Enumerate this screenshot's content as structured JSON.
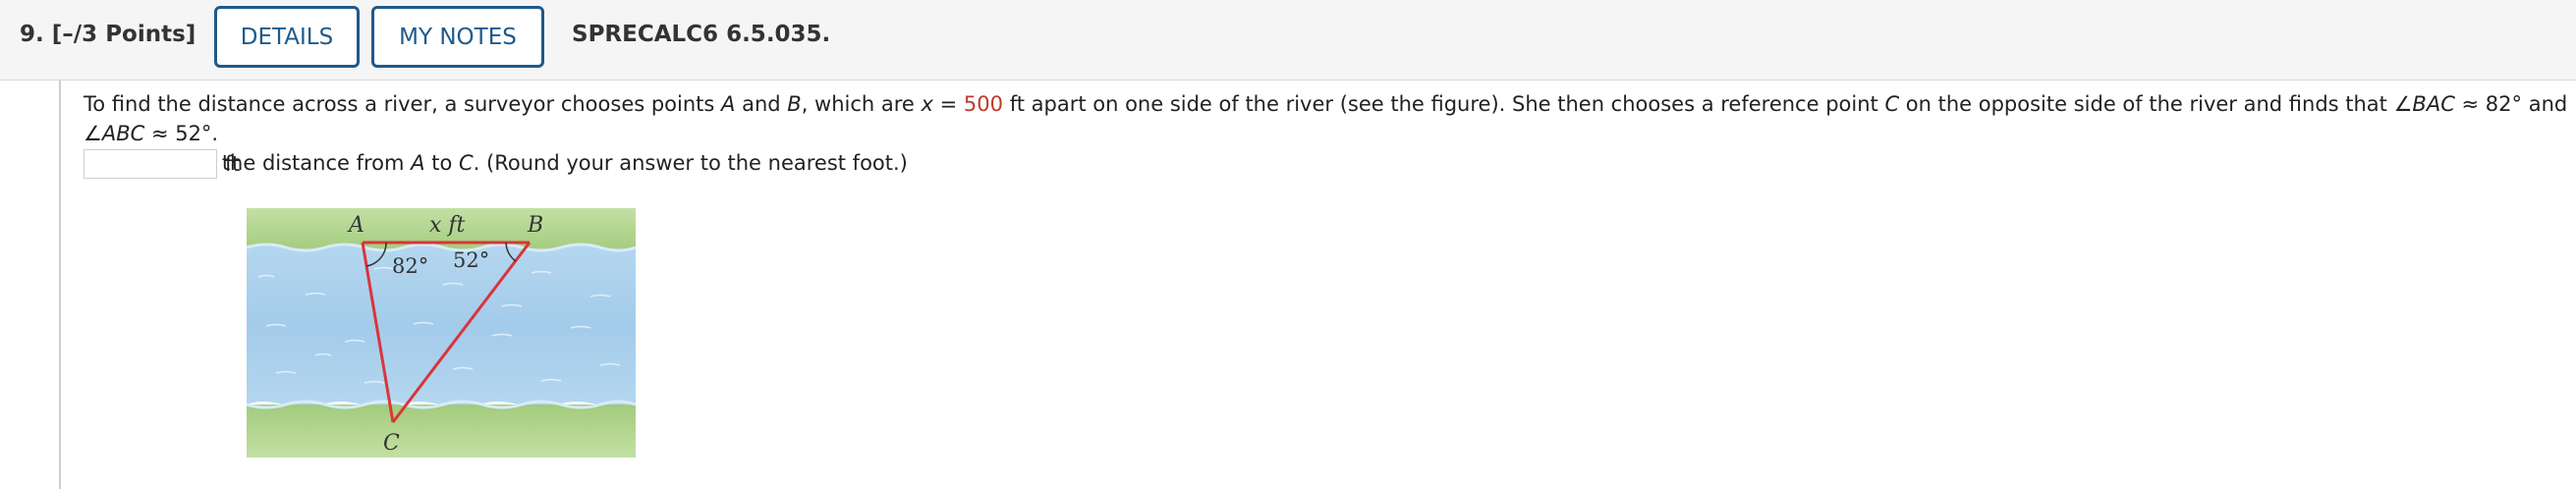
{
  "header": {
    "question_number": "9.",
    "points": "[–/3 Points]",
    "details_label": "DETAILS",
    "notes_label": "MY NOTES",
    "code": "SPRECALC6 6.5.035."
  },
  "question": {
    "part1": "To find the distance across a river, a surveyor chooses points ",
    "A": "A",
    "and1": " and ",
    "B": "B",
    "part2": ", which are ",
    "x": "x",
    "eq": " = ",
    "value": "500",
    "part3": " ft apart on one side of the river (see the figure). She then chooses a reference point ",
    "C": "C",
    "part4": " on the opposite side of the river and finds that ∠",
    "BAC": "BAC",
    "part5": " ≈ 82° and ∠",
    "ABC": "ABC",
    "part6": " ≈ 52°.",
    "line2a": "Approximate the distance from ",
    "A2": "A",
    "to": " to ",
    "C2": "C",
    "line2b": ". (Round your answer to the nearest foot.)"
  },
  "answer": {
    "value": "",
    "unit": "ft"
  },
  "figure": {
    "label_A": "A",
    "label_B": "B",
    "label_C": "C",
    "label_x": "x ft",
    "angle_A": "82°",
    "angle_B": "52°",
    "colors": {
      "grass": "#a9cf84",
      "water": "#a7cdea",
      "triangle": "#d9353a"
    }
  }
}
